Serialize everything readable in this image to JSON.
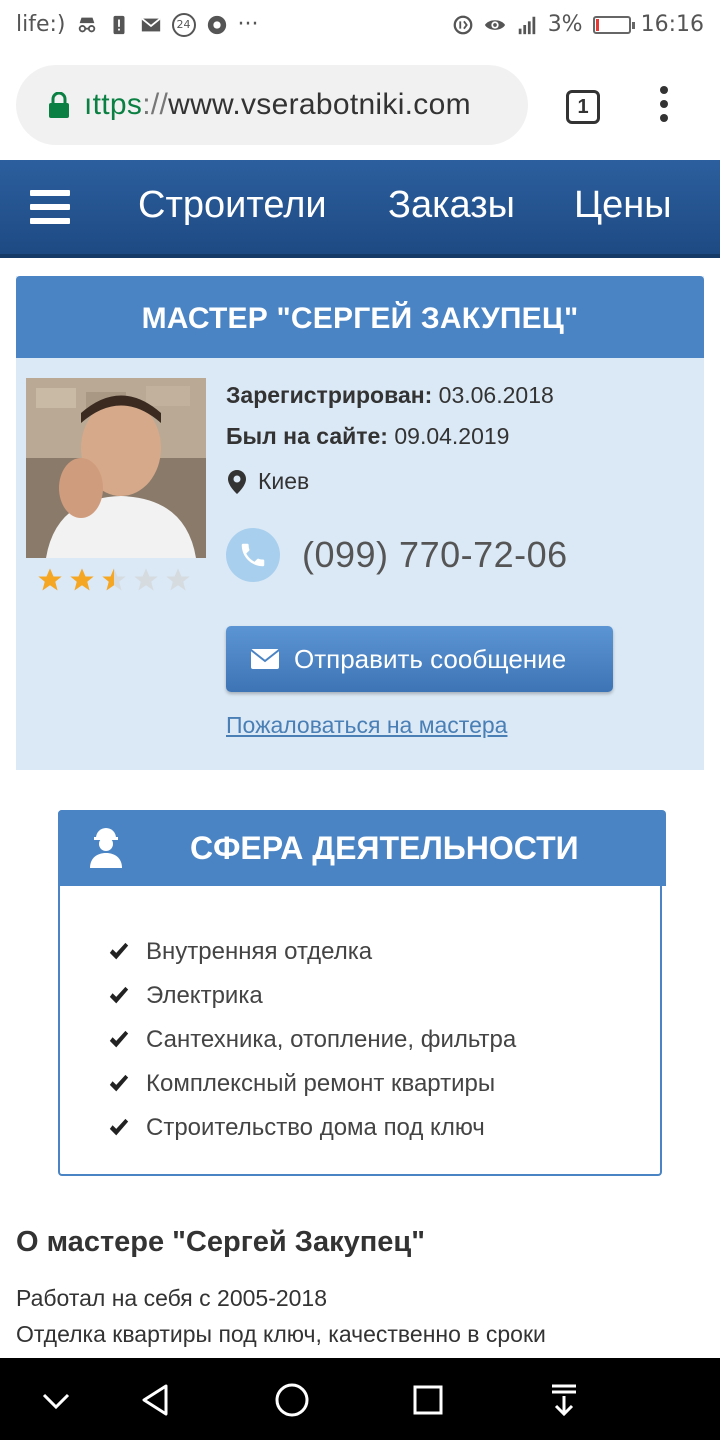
{
  "status_bar": {
    "carrier": "life:)",
    "notification_badge": "24",
    "more": "···",
    "battery_percent": "3%",
    "time": "16:16",
    "icons": [
      "incognito-icon",
      "alert-icon",
      "mail-icon",
      "chrome-icon",
      "data-saver-icon",
      "eye-icon",
      "signal-icon",
      "battery-icon"
    ]
  },
  "browser": {
    "url_protocol": "ıttps",
    "url_separator": "://",
    "url_host": "www.vserabotniki.com",
    "tab_count": "1"
  },
  "site_nav": {
    "items": [
      {
        "label": "Строители"
      },
      {
        "label": "Заказы"
      },
      {
        "label": "Цены"
      }
    ]
  },
  "profile": {
    "title": "МАСТЕР \"СЕРГЕЙ ЗАКУПЕЦ\"",
    "registered_label": "Зарегистрирован:",
    "registered_value": "03.06.2018",
    "last_seen_label": "Был на сайте:",
    "last_seen_value": "09.04.2019",
    "city": "Киев",
    "phone": "(099) 770-72-06",
    "rating": 2.5,
    "rating_max": 5,
    "send_message": "Отправить сообщение",
    "complain": "Пожаловаться на мастера"
  },
  "activity": {
    "title": "СФЕРА ДЕЯТЕЛЬНОСТИ",
    "items": [
      "Внутренняя отделка",
      "Электрика",
      "Сантехника, отопление, фильтра",
      "Комплексный ремонт квартиры",
      "Строительство дома под ключ"
    ]
  },
  "about": {
    "title": "О мастере \"Сергей Закупец\"",
    "lines": [
      "Работал на себя с 2005-2018",
      "Отделка квартиры под ключ, качественно в сроки"
    ]
  },
  "colors": {
    "nav_blue": "#1e4a83",
    "header_blue": "#4a84c4",
    "card_bg": "#dbe9f6",
    "link": "#4a7fb5",
    "star": "#f5a623"
  }
}
